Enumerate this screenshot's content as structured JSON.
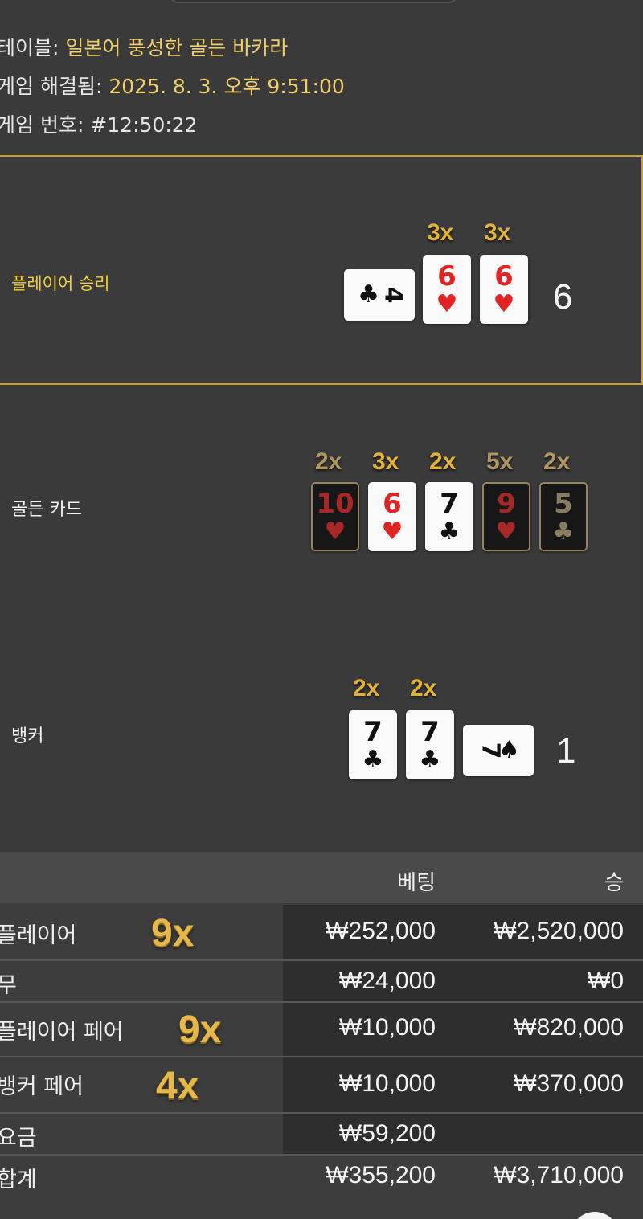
{
  "info": {
    "table_label": "테이블:",
    "table_value": "일본어 풍성한 골든 바카라",
    "resolved_label": "게임 해결됨:",
    "resolved_value": "2025. 8. 3. 오후 9:51:00",
    "number_label": "게임 번호:",
    "number_value": "#12:50:22"
  },
  "player": {
    "label": "플레이어 승리",
    "score": "6",
    "cards": [
      {
        "rank": "4",
        "suit": "♣",
        "color": "black",
        "sideways": true,
        "mult": ""
      },
      {
        "rank": "6",
        "suit": "♥",
        "color": "red",
        "mult": "3x"
      },
      {
        "rank": "6",
        "suit": "♥",
        "color": "red",
        "mult": "3x"
      }
    ]
  },
  "golden": {
    "label": "골든 카드",
    "cards": [
      {
        "rank": "10",
        "suit": "♥",
        "color": "red",
        "dark": true,
        "mult": "2x"
      },
      {
        "rank": "6",
        "suit": "♥",
        "color": "red",
        "mult": "3x"
      },
      {
        "rank": "7",
        "suit": "♣",
        "color": "black",
        "mult": "2x"
      },
      {
        "rank": "9",
        "suit": "♥",
        "color": "red",
        "dark": true,
        "mult": "5x"
      },
      {
        "rank": "5",
        "suit": "♣",
        "color": "black",
        "dark": true,
        "mult": "2x"
      }
    ]
  },
  "banker": {
    "label": "뱅커",
    "score": "1",
    "cards": [
      {
        "rank": "7",
        "suit": "♣",
        "color": "black",
        "mult": "2x"
      },
      {
        "rank": "7",
        "suit": "♣",
        "color": "black",
        "mult": "2x"
      },
      {
        "rank": "7",
        "suit": "♠",
        "color": "black",
        "sideways": true,
        "mult": ""
      }
    ]
  },
  "table": {
    "col_bet": "베팅",
    "col_win": "승",
    "rows": [
      {
        "label": "플레이어",
        "mult": "9x",
        "bet": "₩252,000",
        "win": "₩2,520,000"
      },
      {
        "label": "무",
        "mult": "",
        "bet": "₩24,000",
        "win": "₩0"
      },
      {
        "label": "플레이어 페어",
        "mult": "9x",
        "bet": "₩10,000",
        "win": "₩820,000"
      },
      {
        "label": "뱅커 페어",
        "mult": "4x",
        "bet": "₩10,000",
        "win": "₩370,000"
      },
      {
        "label": "요금",
        "mult": "",
        "bet": "₩59,200",
        "win": ""
      },
      {
        "label": "합계",
        "mult": "",
        "bet": "₩355,200",
        "win": "₩3,710,000"
      }
    ]
  },
  "colors": {
    "accent_gold": "#c9a227",
    "multiplier_gold": "#e2b33a",
    "card_red": "#e02424",
    "background": "#3a3a3a"
  }
}
